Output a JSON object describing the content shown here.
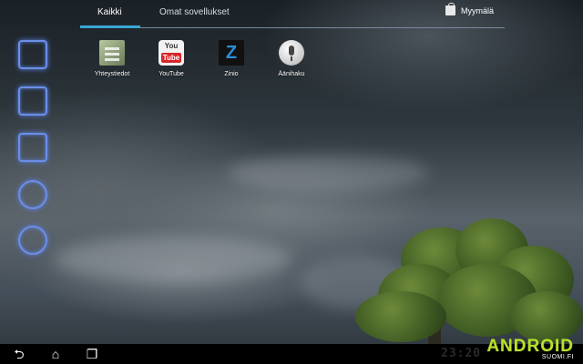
{
  "tabs": {
    "all": "Kaikki",
    "own": "Omat sovellukset",
    "store": "Myymälä"
  },
  "apps": [
    {
      "label": "Yhteystiedot",
      "icon": "contacts-icon"
    },
    {
      "label": "YouTube",
      "icon": "youtube-icon",
      "logo_top": "You",
      "logo_bottom": "Tube"
    },
    {
      "label": "Zinio",
      "icon": "zinio-icon"
    },
    {
      "label": "Äänihaku",
      "icon": "voice-search-icon"
    }
  ],
  "nav": {
    "back": "⮌",
    "home": "⌂",
    "recent": "❐"
  },
  "status": {
    "clock": "23:20"
  },
  "brand": {
    "main": "ANDROID",
    "sub": "SUOMI.FI"
  },
  "colors": {
    "accent": "#39a6d6",
    "dock_glow": "#6b8fe8",
    "brand_green": "#b8e02a"
  }
}
